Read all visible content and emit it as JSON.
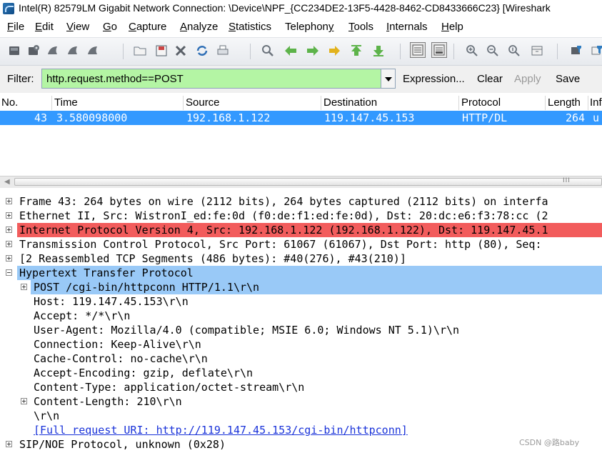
{
  "window": {
    "title": "Intel(R) 82579LM Gigabit Network Connection: \\Device\\NPF_{CC234DE2-13F5-4428-8462-CD8433666C23}   [Wireshark"
  },
  "menu": [
    {
      "first": "F",
      "rest": "ile"
    },
    {
      "first": "E",
      "rest": "dit"
    },
    {
      "first": "V",
      "rest": "iew"
    },
    {
      "first": "G",
      "rest": "o"
    },
    {
      "first": "C",
      "rest": "apture"
    },
    {
      "first": "A",
      "rest": "nalyze"
    },
    {
      "first": "S",
      "rest": "tatistics"
    },
    {
      "first": "",
      "rest": "Telephon",
      "tail_ul": "y"
    },
    {
      "first": "T",
      "rest": "ools"
    },
    {
      "first": "I",
      "rest": "nternals"
    },
    {
      "first": "H",
      "rest": "elp"
    }
  ],
  "toolbar_icons": [
    "interface-list-icon",
    "capture-options-icon",
    "start-capture-icon",
    "stop-capture-icon",
    "restart-capture-icon",
    "open-file-icon",
    "save-file-icon",
    "close-file-icon",
    "reload-icon",
    "print-icon",
    "find-packet-icon",
    "go-back-icon",
    "go-forward-icon",
    "go-to-packet-icon",
    "go-first-icon",
    "go-last-icon",
    "colorize-icon",
    "auto-scroll-icon",
    "zoom-in-icon",
    "zoom-out-icon",
    "normal-size-icon",
    "resize-columns-icon",
    "capture-filters-icon",
    "display-filters-icon"
  ],
  "filter": {
    "label": "Filter:",
    "value": "http.request.method==POST",
    "expression": "Expression...",
    "clear": "Clear",
    "apply": "Apply",
    "save": "Save",
    "input_color": "#b4f5a4"
  },
  "packet_list": {
    "headers": [
      "No.",
      "Time",
      "Source",
      "Destination",
      "Protocol",
      "Length",
      "Inf"
    ],
    "rows": [
      {
        "no": "43",
        "time": "3.580098000",
        "source": "192.168.1.122",
        "destination": "119.147.45.153",
        "protocol": "HTTP/DL",
        "length": "264",
        "info": "u"
      }
    ],
    "selected_color": "#3399ff"
  },
  "scroll": {
    "grip": "III"
  },
  "details": [
    {
      "text": "Frame 43: 264 bytes on wire (2112 bits), 264 bytes captured (2112 bits) on interfa",
      "expander": "plus",
      "indent": 0
    },
    {
      "text": "Ethernet II, Src: WistronI_ed:fe:0d (f0:de:f1:ed:fe:0d), Dst: 20:dc:e6:f3:78:cc (2",
      "expander": "plus",
      "indent": 0
    },
    {
      "text": "Internet Protocol Version 4, Src: 192.168.1.122 (192.168.1.122), Dst: 119.147.45.1",
      "expander": "plus",
      "indent": 0,
      "highlight": "red"
    },
    {
      "text": "Transmission Control Protocol, Src Port: 61067 (61067), Dst Port: http (80), Seq:",
      "expander": "plus",
      "indent": 0
    },
    {
      "text": "[2 Reassembled TCP Segments (486 bytes): #40(276), #43(210)]",
      "expander": "plus",
      "indent": 0
    },
    {
      "text": "Hypertext Transfer Protocol",
      "expander": "minus",
      "indent": 0,
      "highlight": "blue"
    },
    {
      "text": "POST /cgi-bin/httpconn HTTP/1.1\\r\\n",
      "expander": "plus",
      "indent": 1,
      "highlight": "blue"
    },
    {
      "text": "Host: 119.147.45.153\\r\\n",
      "expander": "",
      "indent": 1
    },
    {
      "text": "Accept: */*\\r\\n",
      "expander": "",
      "indent": 1
    },
    {
      "text": "User-Agent: Mozilla/4.0 (compatible; MSIE 6.0; Windows NT 5.1)\\r\\n",
      "expander": "",
      "indent": 1
    },
    {
      "text": "Connection: Keep-Alive\\r\\n",
      "expander": "",
      "indent": 1
    },
    {
      "text": "Cache-Control: no-cache\\r\\n",
      "expander": "",
      "indent": 1
    },
    {
      "text": "Accept-Encoding: gzip, deflate\\r\\n",
      "expander": "",
      "indent": 1
    },
    {
      "text": "Content-Type: application/octet-stream\\r\\n",
      "expander": "",
      "indent": 1
    },
    {
      "text": "Content-Length: 210\\r\\n",
      "expander": "plus",
      "indent": 1
    },
    {
      "text": "\\r\\n",
      "expander": "",
      "indent": 1
    },
    {
      "text": "[Full request URI: http://119.147.45.153/cgi-bin/httpconn]",
      "expander": "",
      "indent": 1,
      "link": true
    },
    {
      "text": "SIP/NOE Protocol, unknown (0x28)",
      "expander": "plus",
      "indent": 0
    }
  ],
  "watermark": "CSDN @路baby"
}
